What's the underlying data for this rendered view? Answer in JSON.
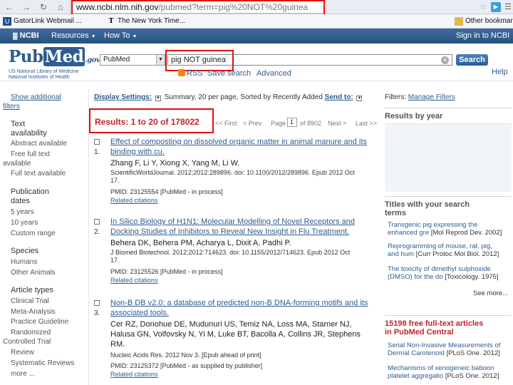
{
  "browser": {
    "url_host": "www.ncbi.nlm.nih.gov",
    "url_path": "/pubmed?term=pig%20NOT%20guinea",
    "bookmarks": [
      "GatorLink Webmail ...",
      "The New York Time...",
      "Other bookmar"
    ]
  },
  "ncbi": {
    "brand": "NCBI",
    "resources": "Resources",
    "howto": "How To",
    "signin": "Sign in to NCBI"
  },
  "pubmed": {
    "logo_pub": "Pub",
    "logo_med": "Med",
    "logo_gov": ".gov",
    "org_line1": "US National Library of Medicine",
    "org_line2": "National Institutes of Health",
    "db": "PubMed",
    "query": "pig NOT guinea",
    "search_label": "Search",
    "rss": "RSS",
    "save_search": "Save search",
    "advanced": "Advanced",
    "help": "Help"
  },
  "sidebar": {
    "show_additional_1": "Show additional",
    "show_additional_2": "filters",
    "groups": [
      {
        "heading": [
          "Text",
          "availability"
        ],
        "items": [
          "Abstract available",
          "Free full text",
          "available",
          "Full text available"
        ]
      },
      {
        "heading": [
          "Publication",
          "dates"
        ],
        "items": [
          "5 years",
          "10 years",
          "Custom range"
        ]
      },
      {
        "heading": [
          "Species"
        ],
        "items": [
          "Humans",
          "Other Animals"
        ]
      },
      {
        "heading": [
          "Article types"
        ],
        "items": [
          "Clinical Trial",
          "Meta-Analysis",
          "Practice Guideline",
          "Randomized",
          "Controlled Trial",
          "Review",
          "Systematic Reviews",
          "more ..."
        ]
      }
    ]
  },
  "display": {
    "label": "Display Settings:",
    "summary": "Summary, 20 per page, Sorted by Recently Added",
    "send_to": "Send to:"
  },
  "results": {
    "summary": "Results: 1 to 20 of 178022",
    "first": "<< First",
    "prev": "< Prev",
    "page": "Page",
    "page_value": "1",
    "of": "of 8902",
    "next": "Next >",
    "last": "Last >>",
    "items": [
      {
        "num": "1.",
        "title": [
          "Effect of composting on dissolved organic matter in animal manure and its",
          "binding with cu."
        ],
        "authors": "Zhang F, Li Y, Xiong X, Yang M, Li W.",
        "source": [
          "ScientificWorldJournal. 2012;2012:289896. doi: 10.1100/2012/289896. Epub 2012 Oct",
          "17."
        ],
        "pmid": "PMID: 23125554 [PubMed - in process]",
        "related": "Related citations"
      },
      {
        "num": "2.",
        "title": [
          "In Silico Biology of H1N1: Molecular Modelling of Novel Receptors and",
          "Docking Studies of Inhibitors to Reveal New Insight in Flu Treatment."
        ],
        "authors": "Behera DK, Behera PM, Acharya L, Dixit A, Padhi P.",
        "source": [
          "J Biomed Biotechnol. 2012;2012:714623. doi: 10.1155/2012/714623. Epub 2012 Oct",
          "17."
        ],
        "pmid": "PMID: 23125526 [PubMed - in process]",
        "related": "Related citations"
      },
      {
        "num": "3.",
        "title": [
          "Non-B DB v2.0: a database of predicted non-B DNA-forming motifs and its",
          "associated tools."
        ],
        "authors": [
          "Cer RZ, Donohue DE, Mudunuri US, Temiz NA, Loss MA, Starner NJ,",
          "Halusa GN, Volfovsky N, Yi M, Luke BT, Bacolla A, Collins JR, Stephens",
          "RM."
        ],
        "source": [
          "Nucleic Acids Res. 2012 Nov 3. [Epub ahead of print]"
        ],
        "pmid": "PMID: 23125372 [PubMed - as supplied by publisher]",
        "related": "Related citations"
      }
    ]
  },
  "right": {
    "filters_label": "Filters:",
    "manage_filters": "Manage Filters",
    "results_by_year": "Results by year",
    "titles_heading": [
      "Titles with your search",
      "terms"
    ],
    "titles": [
      {
        "lines": [
          "Transgenic pig expressing the",
          "enhanced gre"
        ],
        "src": "[Mol Reprod Dev. 2002]"
      },
      {
        "lines": [
          "Reprogramming of mouse, rat, pig,",
          "and hum"
        ],
        "src": "[Curr Protoc Mol Biol. 2012]"
      },
      {
        "lines": [
          "The toxicity of dimethyl sulphoxide",
          "(DMSO) for the do"
        ],
        "src": "[Toxicology. 1975]"
      }
    ],
    "see_more": "See more...",
    "freetext_heading": [
      "15198 free full-text articles",
      "in PubMed Central"
    ],
    "freetext": [
      {
        "lines": [
          "Serial Non-Invasive Measurements of",
          "Dermal Carotenoid"
        ],
        "src": "[PLoS One. 2012]"
      },
      {
        "lines": [
          "Mechanisms of xenogeneic baboon",
          "platelet aggregatio"
        ],
        "src": "[PLoS One. 2012]"
      }
    ]
  },
  "colors": {
    "link": "#2e5d8f",
    "highlight_box": "#dd1111",
    "results_red": "#c4232b",
    "ncbi_bar": "#27537f"
  }
}
